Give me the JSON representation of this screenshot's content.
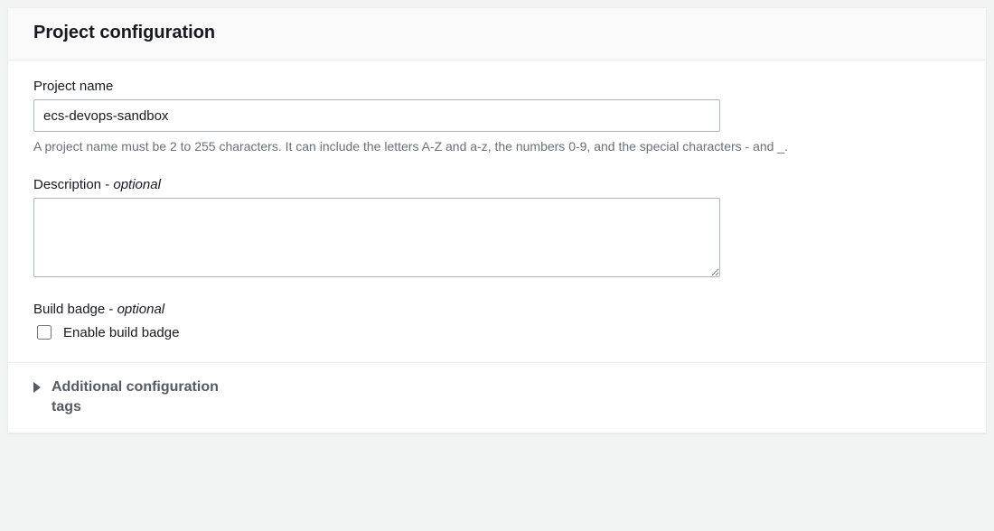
{
  "panel": {
    "title": "Project configuration"
  },
  "projectName": {
    "label": "Project name",
    "value": "ecs-devops-sandbox",
    "help": "A project name must be 2 to 255 characters. It can include the letters A-Z and a-z, the numbers 0-9, and the special characters - and _."
  },
  "description": {
    "label": "Description - ",
    "optional": "optional",
    "value": ""
  },
  "buildBadge": {
    "label": "Build badge - ",
    "optional": "optional",
    "checkboxLabel": "Enable build badge",
    "checked": false
  },
  "expander": {
    "titleLine1": "Additional configuration",
    "titleLine2": "tags"
  }
}
